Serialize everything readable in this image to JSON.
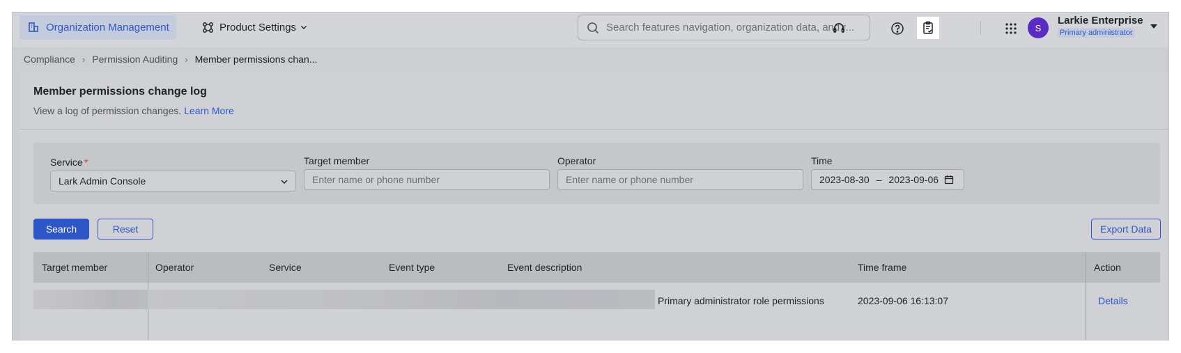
{
  "topbar": {
    "org_tab": "Organization Management",
    "product_tab": "Product Settings",
    "search_placeholder": "Search features navigation, organization data, and r...",
    "user": {
      "avatar_initial": "S",
      "name": "Larkie Enterprise",
      "role": "Primary administrator"
    },
    "icons": [
      "headset-icon",
      "clipboard-check-icon",
      "help-icon",
      "apps-grid-icon"
    ]
  },
  "breadcrumb": {
    "items": [
      "Compliance",
      "Permission Auditing",
      "Member permissions chan..."
    ]
  },
  "page": {
    "title": "Member permissions change log",
    "subtitle": "View a log of permission changes.",
    "learn_more": "Learn More"
  },
  "filters": {
    "service": {
      "label": "Service",
      "required_mark": "*",
      "value": "Lark Admin Console"
    },
    "target_member": {
      "label": "Target member",
      "placeholder": "Enter name or phone number"
    },
    "operator": {
      "label": "Operator",
      "placeholder": "Enter name or phone number"
    },
    "time": {
      "label": "Time",
      "start": "2023-08-30",
      "separator": "–",
      "end": "2023-09-06"
    }
  },
  "actions": {
    "search": "Search",
    "reset": "Reset",
    "export": "Export Data"
  },
  "table": {
    "columns": [
      "Target member",
      "Operator",
      "Service",
      "Event type",
      "Event description",
      "Time frame",
      "Action"
    ],
    "rows": [
      {
        "event_description": "Primary administrator role permissions",
        "time_frame": "2023-09-06 16:13:07",
        "action": "Details"
      }
    ]
  },
  "colors": {
    "accent": "#2f56c9",
    "required": "#d83931",
    "avatar": "#5a2bc4"
  }
}
